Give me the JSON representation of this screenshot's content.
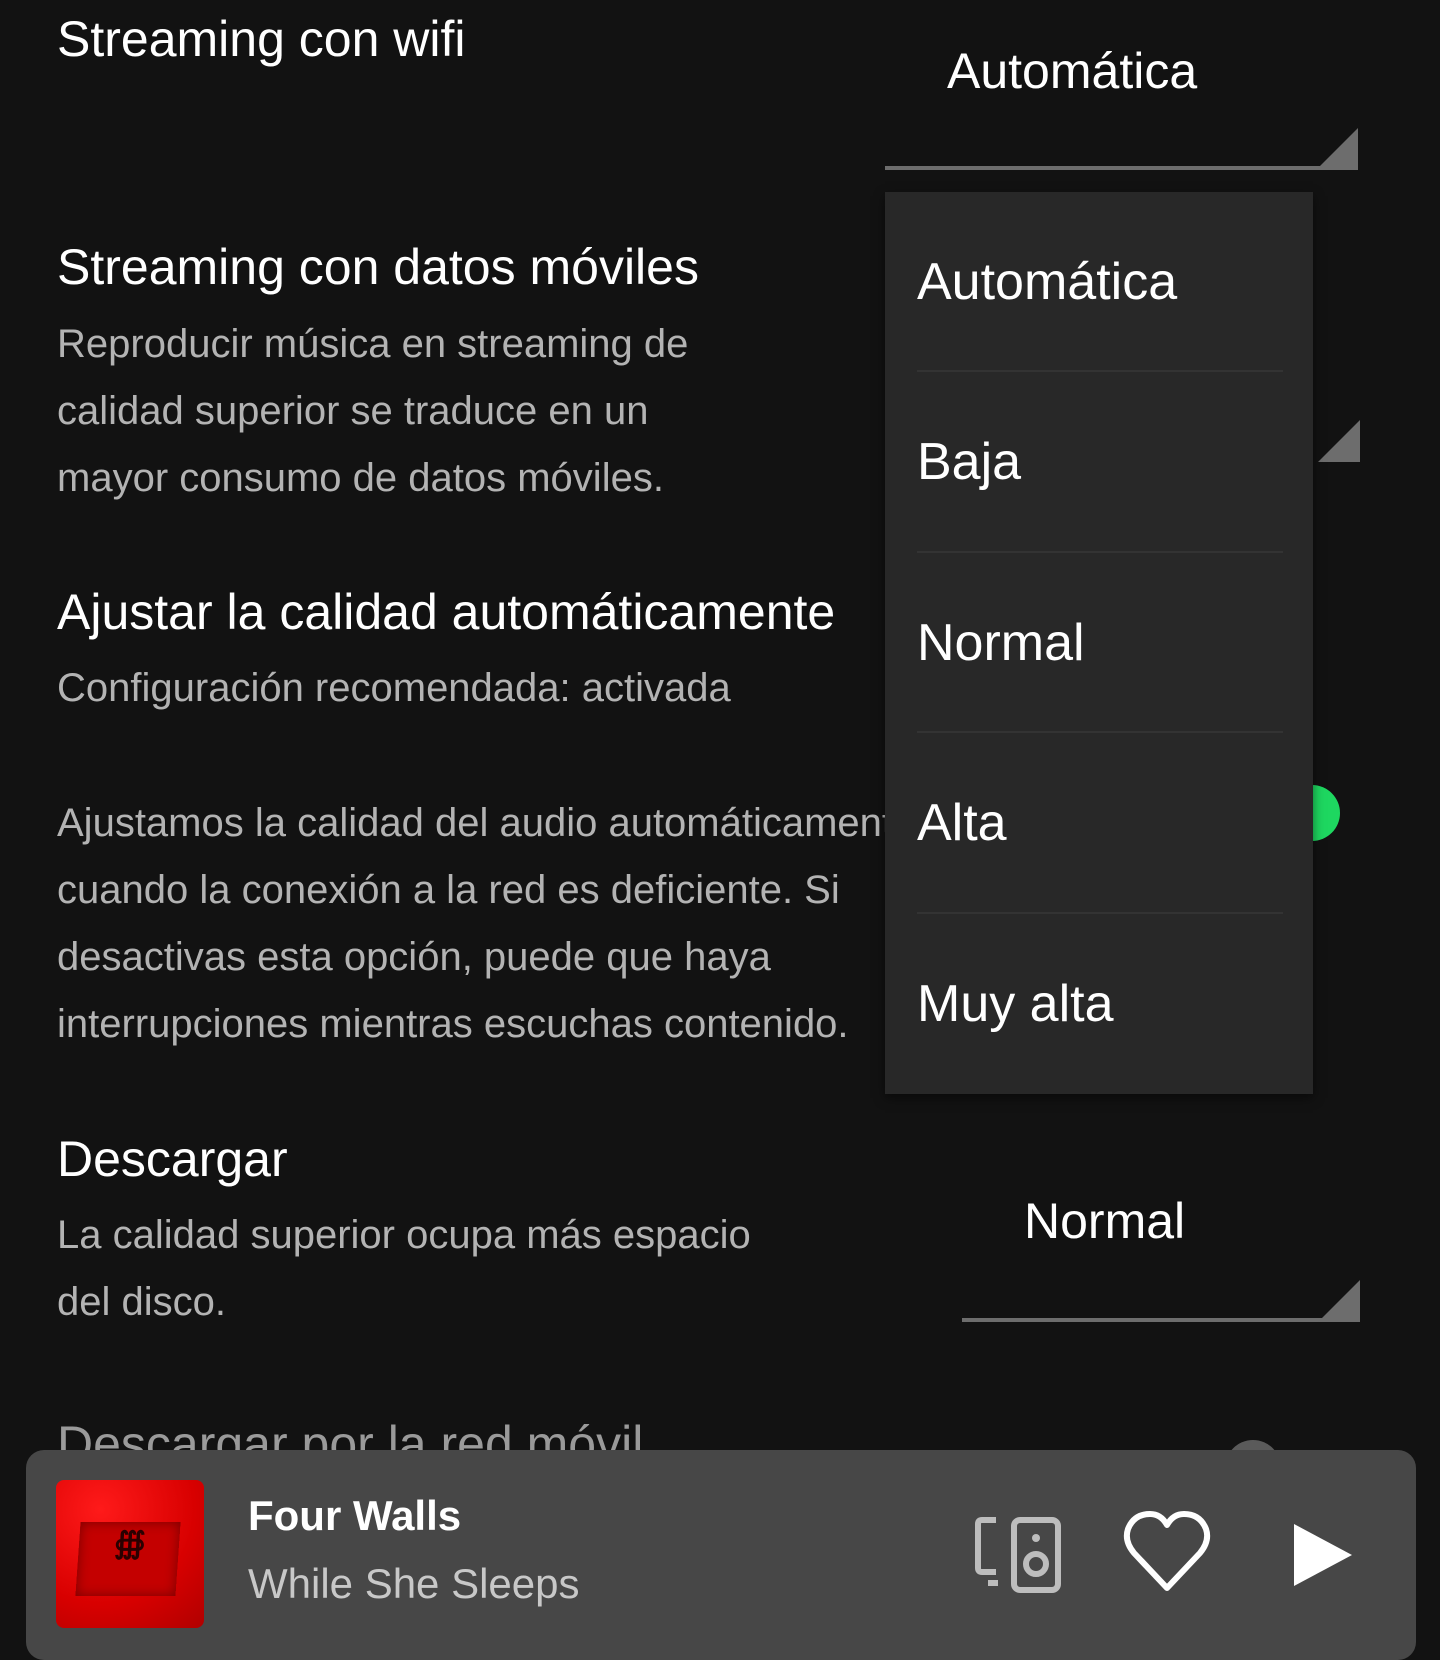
{
  "settings": {
    "wifi_streaming": {
      "title": "Streaming con wifi",
      "selected": "Automática"
    },
    "mobile_streaming": {
      "title": "Streaming con datos móviles",
      "description_lines": [
        "Reproducir música en streaming de",
        "calidad superior se traduce en un",
        "mayor consumo de datos móviles."
      ]
    },
    "auto_quality": {
      "title": "Ajustar la calidad automáticamente",
      "subtitle": "Configuración recomendada: activada",
      "description_lines": [
        "Ajustamos la calidad del audio automáticamente",
        "cuando la conexión a la red es deficiente. Si",
        "desactivas esta opción, puede que haya",
        "interrupciones mientras escuchas contenido."
      ],
      "enabled": true
    },
    "download": {
      "title": "Descargar",
      "description_lines": [
        "La calidad superior ocupa más espacio",
        "del disco."
      ],
      "selected": "Normal"
    },
    "download_mobile": {
      "title": "Descargar por la red móvil"
    }
  },
  "dropdown": {
    "options": [
      "Automática",
      "Baja",
      "Normal",
      "Alta",
      "Muy alta"
    ]
  },
  "now_playing": {
    "title": "Four Walls",
    "artist": "While She Sleeps",
    "icons": {
      "devices": "devices-icon",
      "like": "heart-icon",
      "play": "play-icon"
    }
  },
  "colors": {
    "accent": "#1ed760",
    "background": "#121212",
    "dropdown_bg": "#282828",
    "player_bg": "#474747"
  }
}
